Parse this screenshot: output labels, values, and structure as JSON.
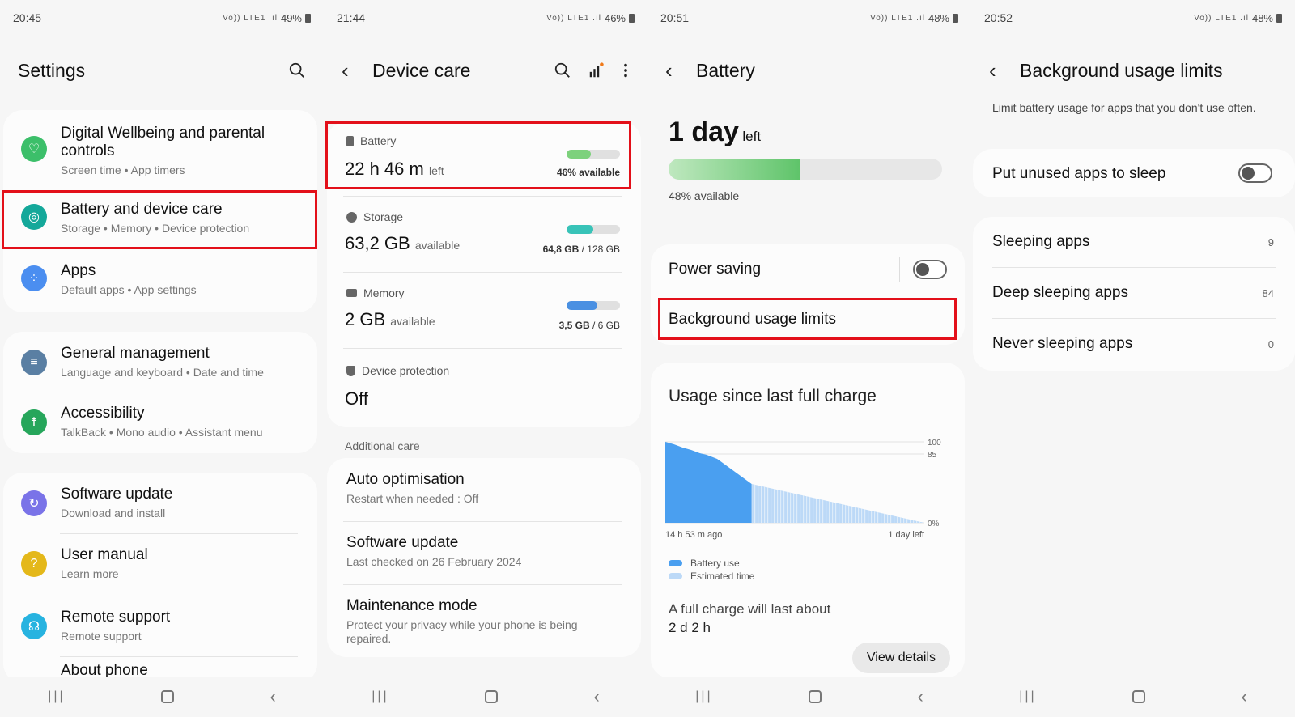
{
  "screens": [
    {
      "status": {
        "time": "20:45",
        "icons": "Vo)) LTE1 .ıl",
        "battery": "49%"
      },
      "title": "Settings",
      "groups": [
        [
          {
            "title": "Digital Wellbeing and parental controls",
            "sub": "Screen time  •  App timers",
            "icon": "wellbeing-icon",
            "color": "#3cbf6a"
          },
          {
            "title": "Battery and device care",
            "sub": "Storage  •  Memory  •  Device protection",
            "icon": "device-care-icon",
            "color": "#14a89a"
          },
          {
            "title": "Apps",
            "sub": "Default apps  •  App settings",
            "icon": "apps-icon",
            "color": "#4b8ef0"
          }
        ],
        [
          {
            "title": "General management",
            "sub": "Language and keyboard  •  Date and time",
            "icon": "sliders-icon",
            "color": "#5a7fa3"
          },
          {
            "title": "Accessibility",
            "sub": "TalkBack  •  Mono audio  •  Assistant menu",
            "icon": "accessibility-icon",
            "color": "#26a65b"
          }
        ],
        [
          {
            "title": "Software update",
            "sub": "Download and install",
            "icon": "update-icon",
            "color": "#7a73e8"
          },
          {
            "title": "User manual",
            "sub": "Learn more",
            "icon": "manual-icon",
            "color": "#e4b81a"
          },
          {
            "title": "Remote support",
            "sub": "Remote support",
            "icon": "headset-icon",
            "color": "#27b3e0"
          },
          {
            "title": "About phone",
            "sub": "",
            "icon": "info-icon",
            "color": "#777777"
          }
        ]
      ]
    },
    {
      "status": {
        "time": "21:44",
        "icons": "Vo)) LTE1 .ıl",
        "battery": "46%"
      },
      "title": "Device care",
      "items": {
        "battery": {
          "label": "Battery",
          "value": "22 h 46 m",
          "unit": "left",
          "right": "46% available",
          "fill": 0.46,
          "color": "#7dd17c"
        },
        "storage": {
          "label": "Storage",
          "value": "63,2 GB",
          "unit": "available",
          "right_bold": "64,8 GB",
          "right_rest": " / 128 GB",
          "fill": 0.5,
          "color": "#38c3b8"
        },
        "memory": {
          "label": "Memory",
          "value": "2 GB",
          "unit": "available",
          "right_bold": "3,5 GB",
          "right_rest": " / 6 GB",
          "fill": 0.58,
          "color": "#4a90e2"
        },
        "protection": {
          "label": "Device protection",
          "value": "Off"
        }
      },
      "additional_header": "Additional care",
      "additional": [
        {
          "title": "Auto optimisation",
          "sub": "Restart when needed : Off"
        },
        {
          "title": "Software update",
          "sub": "Last checked on 26 February 2024"
        },
        {
          "title": "Maintenance mode",
          "sub": "Protect your privacy while your phone is being repaired."
        }
      ]
    },
    {
      "status": {
        "time": "20:51",
        "icons": "Vo)) LTE1 .ıl",
        "battery": "48%"
      },
      "title": "Battery",
      "hero": {
        "value": "1 day",
        "unit": "left",
        "available": "48% available",
        "fill": 0.48
      },
      "power_saving": "Power saving",
      "background_limits": "Background usage limits",
      "usage_title": "Usage since last full charge",
      "chart_data": {
        "type": "area",
        "ylim": [
          0,
          100
        ],
        "ytick_labels": [
          "100",
          "85",
          "0%"
        ],
        "ytick_values": [
          100,
          85,
          0
        ],
        "xtick_labels": [
          "14 h 53 m ago",
          "1 day left"
        ],
        "series": [
          {
            "name": "Battery use",
            "color": "#4a9ff0",
            "values": [
              [
                0,
                100
              ],
              [
                0.1,
                97
              ],
              [
                0.2,
                93
              ],
              [
                0.3,
                90
              ],
              [
                0.4,
                86
              ],
              [
                0.48,
                84
              ],
              [
                0.6,
                79
              ],
              [
                1.0,
                48
              ]
            ]
          },
          {
            "name": "Estimated time",
            "color": "#bcd9f7",
            "values": [
              [
                1.0,
                48
              ],
              [
                3.0,
                0
              ]
            ]
          }
        ],
        "xlim": [
          0,
          3.0
        ]
      },
      "full_charge_label": "A full charge will last about",
      "full_charge_value": "2 d 2 h",
      "view_details": "View details"
    },
    {
      "status": {
        "time": "20:52",
        "icons": "Vo)) LTE1 .ıl",
        "battery": "48%"
      },
      "title": "Background usage limits",
      "description": "Limit battery usage for apps that you don't use often.",
      "sleep_toggle": "Put unused apps to sleep",
      "lists": [
        {
          "title": "Sleeping apps",
          "count": "9"
        },
        {
          "title": "Deep sleeping apps",
          "count": "84"
        },
        {
          "title": "Never sleeping apps",
          "count": "0"
        }
      ]
    }
  ]
}
